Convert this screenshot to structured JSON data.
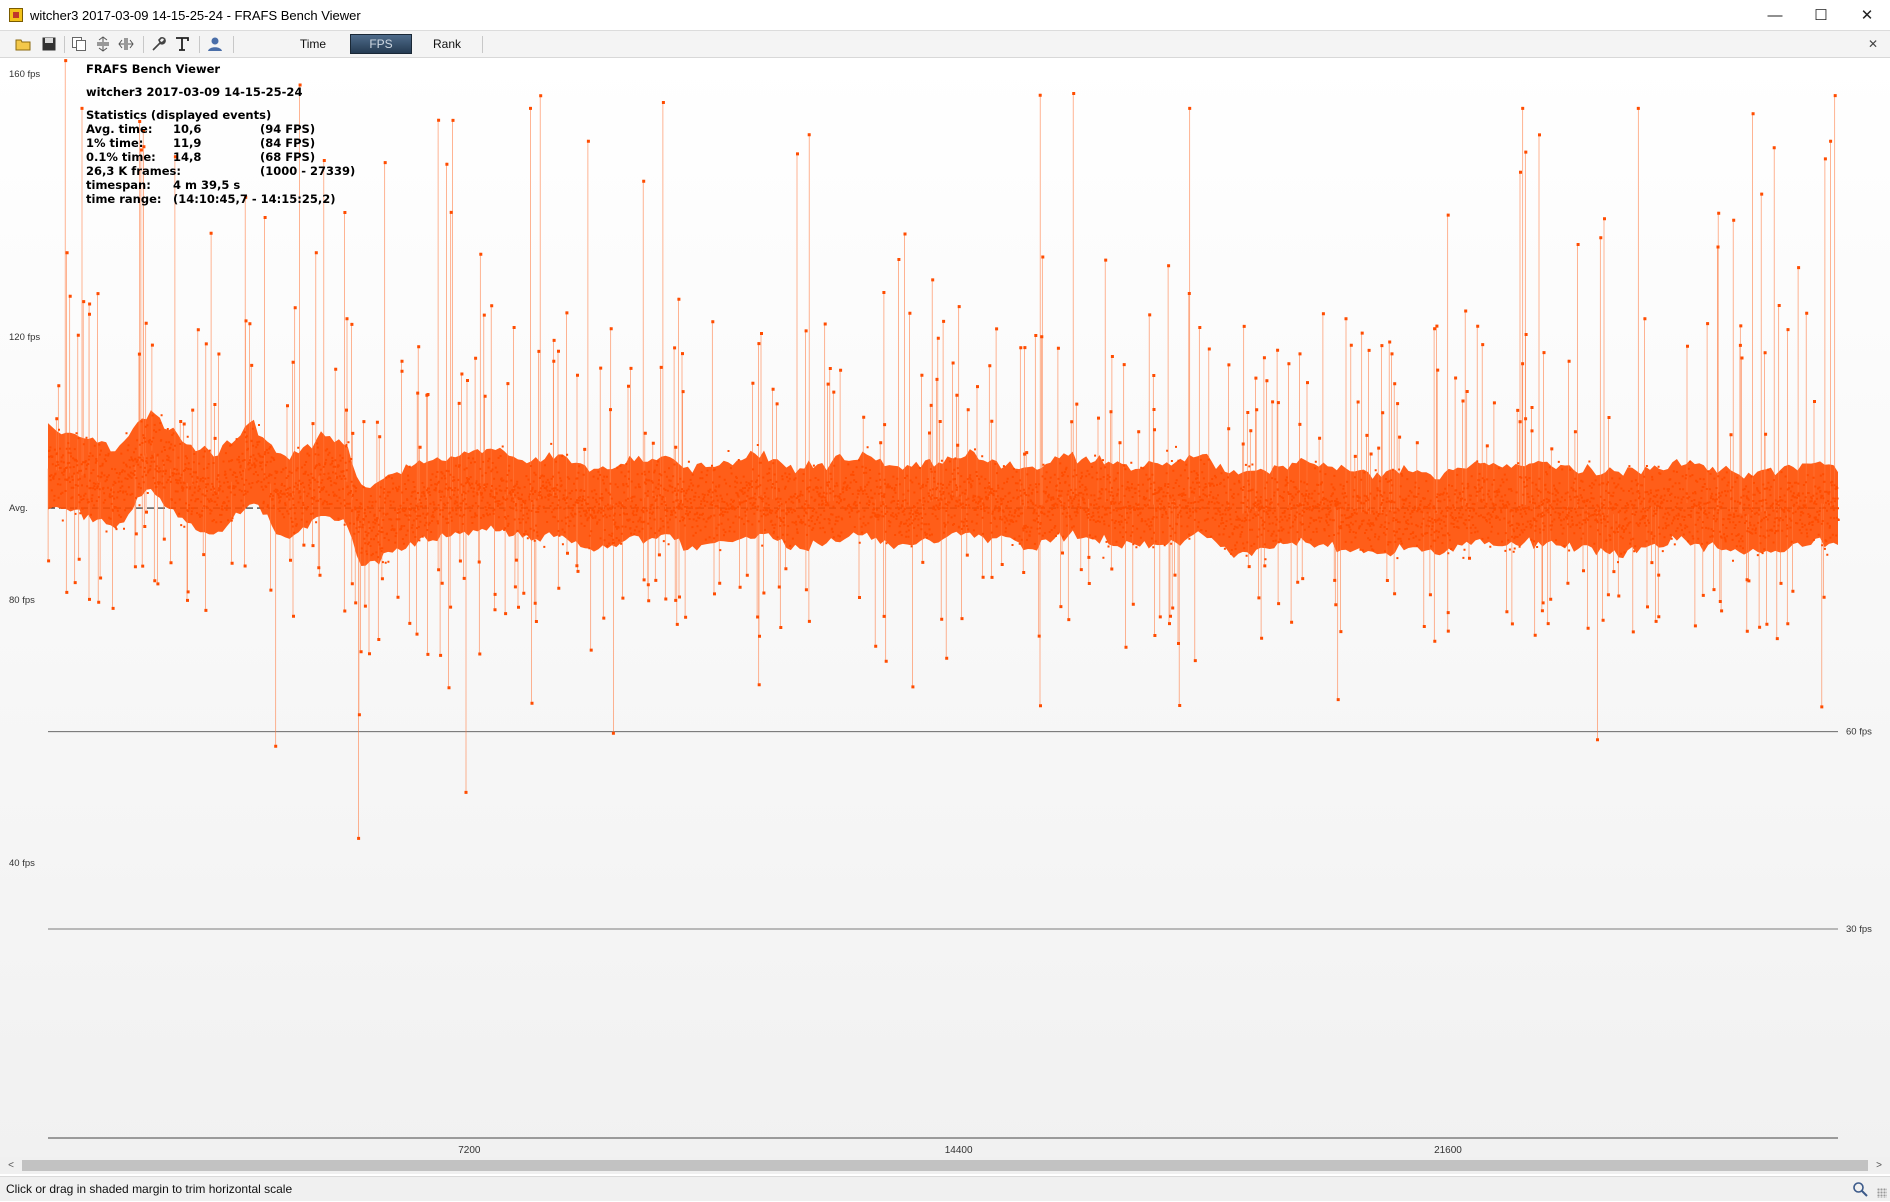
{
  "window": {
    "title": "witcher3 2017-03-09 14-15-25-24 - FRAFS Bench Viewer",
    "minimize": "—",
    "maximize": "☐",
    "close": "✕"
  },
  "toolbar": {
    "icons": [
      "open-folder-icon",
      "save-icon",
      "copy-icon",
      "fit-vertical-icon",
      "fit-horizontal-icon",
      "wrench-icon",
      "text-icon",
      "user-icon"
    ],
    "tabs": [
      {
        "label": "Time",
        "active": false
      },
      {
        "label": "FPS",
        "active": true
      },
      {
        "label": "Rank",
        "active": false
      }
    ],
    "close_tab": "✕"
  },
  "stats": {
    "app_name": "FRAFS Bench Viewer",
    "file_name": "witcher3 2017-03-09 14-15-25-24",
    "heading": "Statistics (displayed events)",
    "rows": [
      {
        "label": "Avg. time:",
        "value": "10,6",
        "extra": "(94 FPS)"
      },
      {
        "label": "1% time:",
        "value": "11,9",
        "extra": "(84 FPS)"
      },
      {
        "label": "0.1% time:",
        "value": "14,8",
        "extra": "(68 FPS)"
      },
      {
        "label": "26,3 K frames:",
        "value": "",
        "extra": "(1000 - 27339)"
      },
      {
        "label": "timespan:",
        "value": "4 m 39,5 s",
        "extra": ""
      },
      {
        "label": "time range:",
        "value": "(14:10:45,7 - 14:15:25,2)",
        "extra": ""
      }
    ]
  },
  "chart_data": {
    "type": "scatter",
    "xlim": [
      1000,
      27339
    ],
    "ylim": [
      30,
      160
    ],
    "x_ticks": [
      7200,
      14400,
      21600
    ],
    "y_ticks": [
      {
        "value": 160,
        "label": "160 fps"
      },
      {
        "value": 120,
        "label": "120 fps"
      },
      {
        "value": 94,
        "label": "Avg."
      },
      {
        "value": 80,
        "label": "80 fps"
      },
      {
        "value": 40,
        "label": "40 fps"
      }
    ],
    "reference_lines": [
      {
        "value": 94,
        "label": "",
        "style": "dashed"
      },
      {
        "value": 60,
        "label": "60 fps",
        "style": "solid"
      },
      {
        "value": 30,
        "label": "30 fps",
        "style": "solid"
      }
    ],
    "series": [
      {
        "band_center_fps": 96,
        "band_halfwidth_fps": 6,
        "points_sample": [
          [
            1000,
            100
          ],
          [
            1500,
            99
          ],
          [
            2000,
            97
          ],
          [
            2500,
            103
          ],
          [
            3000,
            98
          ],
          [
            3500,
            96
          ],
          [
            4000,
            101
          ],
          [
            4500,
            95
          ],
          [
            5000,
            99
          ],
          [
            5400,
            98
          ],
          [
            5600,
            91
          ],
          [
            6000,
            93
          ],
          [
            6500,
            95
          ],
          [
            7000,
            96
          ],
          [
            7500,
            97
          ],
          [
            8000,
            95
          ],
          [
            8500,
            96
          ],
          [
            9000,
            94
          ],
          [
            9500,
            95
          ],
          [
            10000,
            96
          ],
          [
            10500,
            94
          ],
          [
            11000,
            95
          ],
          [
            11500,
            96
          ],
          [
            12000,
            94
          ],
          [
            12500,
            95
          ],
          [
            13000,
            96
          ],
          [
            13500,
            94
          ],
          [
            14000,
            95
          ],
          [
            14500,
            96
          ],
          [
            15000,
            95
          ],
          [
            15500,
            94
          ],
          [
            16000,
            96
          ],
          [
            16500,
            95
          ],
          [
            17000,
            94
          ],
          [
            17500,
            95
          ],
          [
            18000,
            96
          ],
          [
            18500,
            93
          ],
          [
            19000,
            94
          ],
          [
            19500,
            95
          ],
          [
            20000,
            94
          ],
          [
            20500,
            93
          ],
          [
            21000,
            94
          ],
          [
            21500,
            93
          ],
          [
            22000,
            95
          ],
          [
            22500,
            94
          ],
          [
            23000,
            95
          ],
          [
            23500,
            94
          ],
          [
            24000,
            93
          ],
          [
            24500,
            94
          ],
          [
            25000,
            95
          ],
          [
            25500,
            94
          ],
          [
            26000,
            93
          ],
          [
            26500,
            94
          ],
          [
            27000,
            95
          ],
          [
            27339,
            94
          ]
        ],
        "outliers": [
          [
            1500,
            155
          ],
          [
            2350,
            153
          ],
          [
            3400,
            136
          ],
          [
            5400,
            123
          ],
          [
            5570,
            44
          ],
          [
            7150,
            51
          ],
          [
            8100,
            155
          ],
          [
            9320,
            60
          ],
          [
            12200,
            151
          ],
          [
            13300,
            127
          ],
          [
            15600,
            157
          ],
          [
            17800,
            155
          ],
          [
            20100,
            123
          ],
          [
            22700,
            155
          ],
          [
            24400,
            155
          ],
          [
            26400,
            149
          ],
          [
            27100,
            64
          ],
          [
            27230,
            150
          ],
          [
            4350,
            58
          ],
          [
            23800,
            59
          ]
        ]
      }
    ]
  },
  "scrollbar": {
    "left": "<",
    "right": ">"
  },
  "status": {
    "text": "Click or drag in shaded margin to trim horizontal scale"
  }
}
